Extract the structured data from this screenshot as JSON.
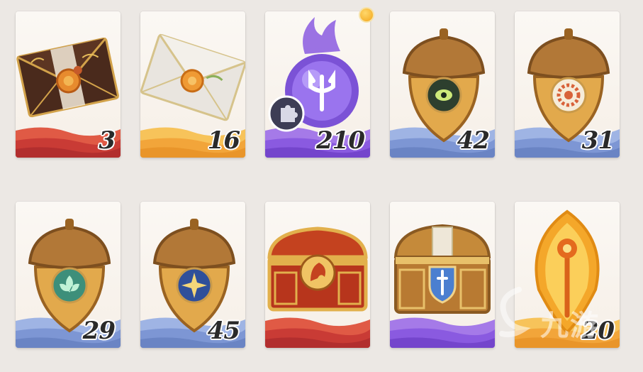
{
  "items": [
    {
      "name": "red-envelope-item",
      "count": "3"
    },
    {
      "name": "white-envelope-item",
      "count": "16"
    },
    {
      "name": "purple-trident-orb-item",
      "count": "210"
    },
    {
      "name": "acorn-shield-eye-item",
      "count": "42"
    },
    {
      "name": "acorn-shield-sun-item",
      "count": "31"
    },
    {
      "name": "acorn-shield-leaf-item",
      "count": "29"
    },
    {
      "name": "acorn-shield-star-item",
      "count": "45"
    },
    {
      "name": "red-treasure-chest-item",
      "count": ""
    },
    {
      "name": "gold-treasure-chest-item",
      "count": ""
    },
    {
      "name": "golden-leaf-scepter-item",
      "count": "20"
    }
  ],
  "watermark": {
    "text": "九游"
  },
  "colors": {
    "red": "#d94a3a",
    "orange": "#f3a22a",
    "purple": "#8a5ae0",
    "blue": "#6f8fd0",
    "gold": "#d7a34a"
  }
}
